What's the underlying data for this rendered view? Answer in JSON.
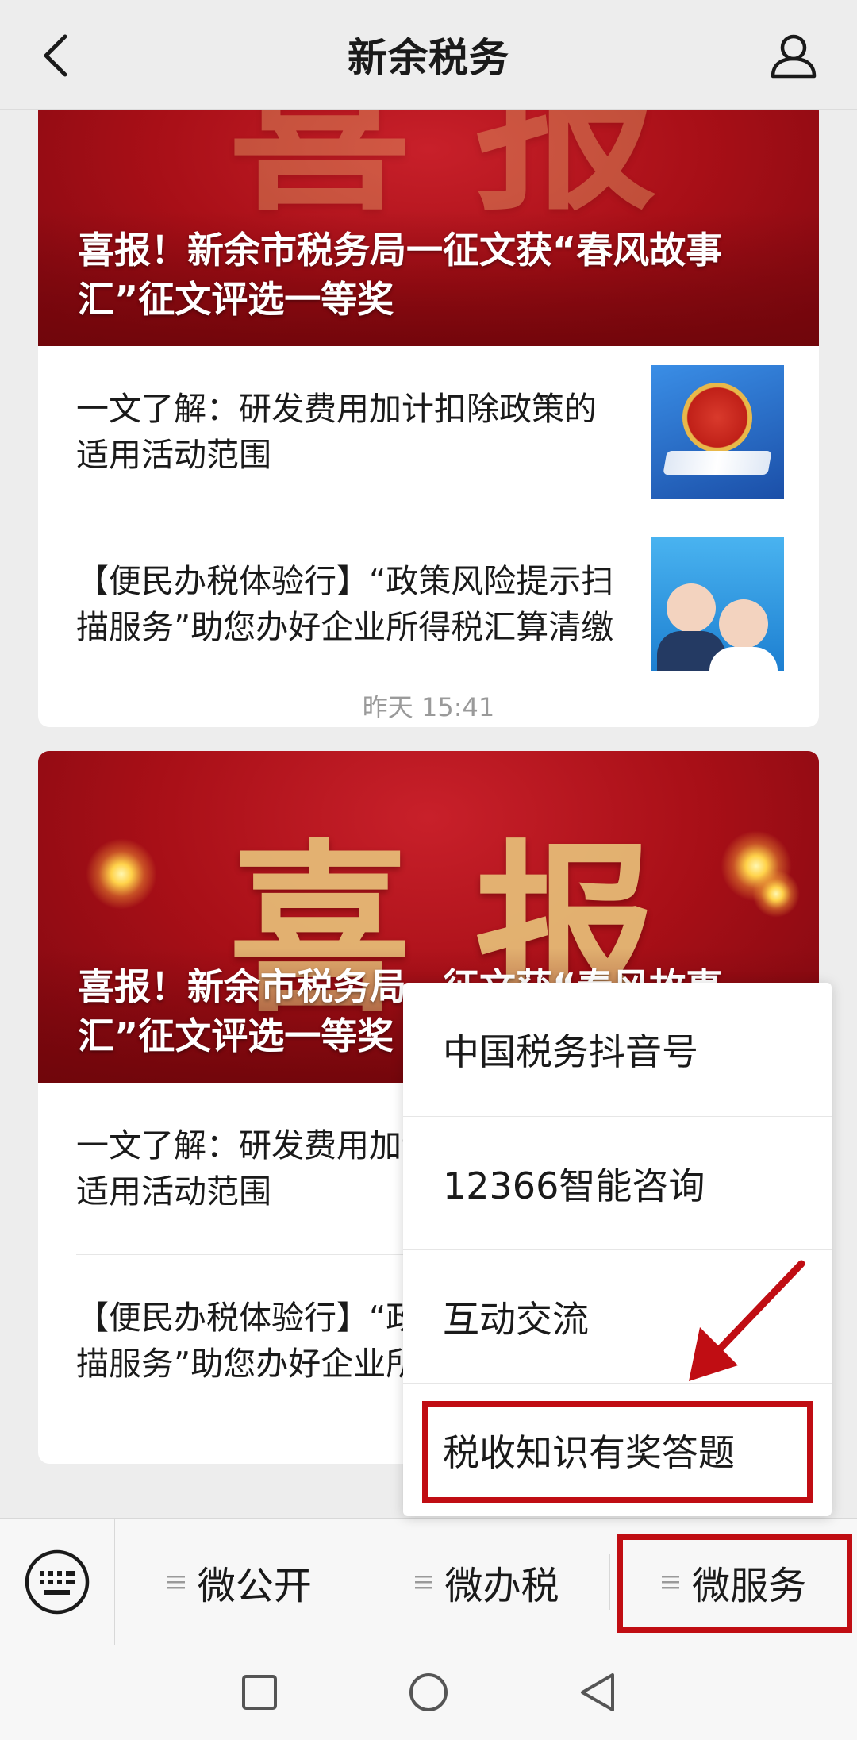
{
  "header": {
    "title": "新余税务"
  },
  "feed": {
    "group1": {
      "cover_title": "喜报！新余市税务局一征文获“春风故事汇”征文评选一等奖",
      "articles": [
        {
          "title": "一文了解：研发费用加计扣除政策的适用活动范围"
        },
        {
          "title": "【便民办税体验行】“政策风险提示扫描服务”助您办好企业所得税汇算清缴"
        }
      ]
    },
    "timestamp": "昨天 15:41",
    "group2": {
      "cover_big_text": "喜报",
      "cover_title": "喜报！新余市税务局一征文获“春风故事汇”征文评选一等奖",
      "articles": [
        {
          "title": "一文了解：研发费用加计扣除政策的适用活动范围"
        },
        {
          "title": "【便民办税体验行】“政策风险提示扫描服务”助您办好企业所得税汇算清缴"
        }
      ]
    }
  },
  "popup_menu": {
    "items": [
      "中国税务抖音号",
      "12366智能咨询",
      "互动交流",
      "税收知识有奖答题"
    ],
    "highlighted_index": 3
  },
  "bottom_menu": {
    "tabs": [
      "微公开",
      "微办税",
      "微服务"
    ],
    "highlighted_index": 2
  },
  "colors": {
    "annotation_red": "#c00d13",
    "cover_red": "#a80f17"
  },
  "icons": [
    "back-arrow-icon",
    "profile-icon",
    "keyboard-icon",
    "menu-lines-icon",
    "recent-apps-icon",
    "home-icon",
    "back-triangle-icon"
  ]
}
